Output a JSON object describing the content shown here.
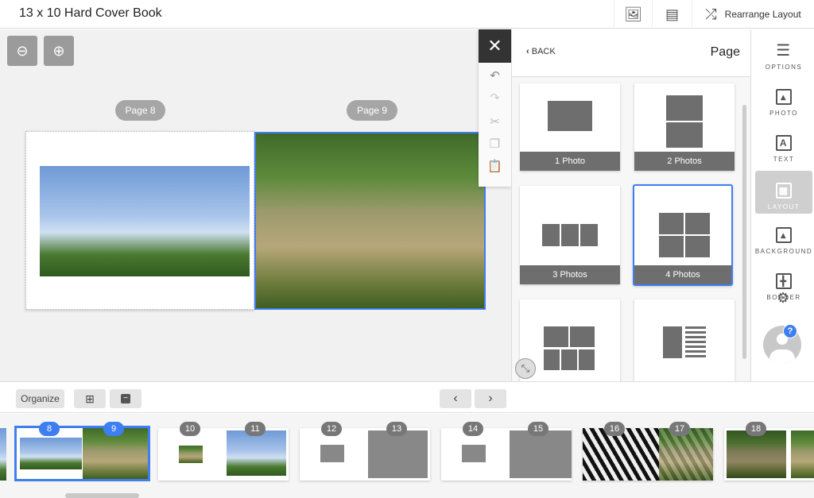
{
  "header": {
    "title": "13 x 10 Hard Cover Book",
    "add_photo_icon": "image-plus-icon",
    "add_text_icon": "note-plus-icon",
    "rearrange_label": "Rearrange Layout"
  },
  "canvas": {
    "zoom_out": "zoom-out-icon",
    "zoom_in": "zoom-in-icon",
    "pages": [
      {
        "label": "Page 8"
      },
      {
        "label": "Page 9"
      }
    ]
  },
  "tools": [
    "undo",
    "redo",
    "cut",
    "copy",
    "paste"
  ],
  "panel": {
    "back": "BACK",
    "title": "Page",
    "layouts": [
      {
        "label": "1 Photo"
      },
      {
        "label": "2 Photos"
      },
      {
        "label": "3 Photos"
      },
      {
        "label": "4 Photos",
        "selected": true
      },
      {
        "label": ""
      },
      {
        "label": ""
      }
    ]
  },
  "sidebar": {
    "items": [
      {
        "label": "OPTIONS"
      },
      {
        "label": "PHOTO"
      },
      {
        "label": "TEXT"
      },
      {
        "label": "LAYOUT",
        "active": true
      },
      {
        "label": "BACKGROUND"
      },
      {
        "label": "BORDER"
      }
    ],
    "help": "?"
  },
  "bottom": {
    "organize": "Organize"
  },
  "thumbnails": [
    "8",
    "9",
    "10",
    "11",
    "12",
    "13",
    "14",
    "15",
    "16",
    "17",
    "18"
  ],
  "colors": {
    "accent": "#3f7ef0",
    "dark": "#333333",
    "placeholder": "#6e6e6e"
  }
}
